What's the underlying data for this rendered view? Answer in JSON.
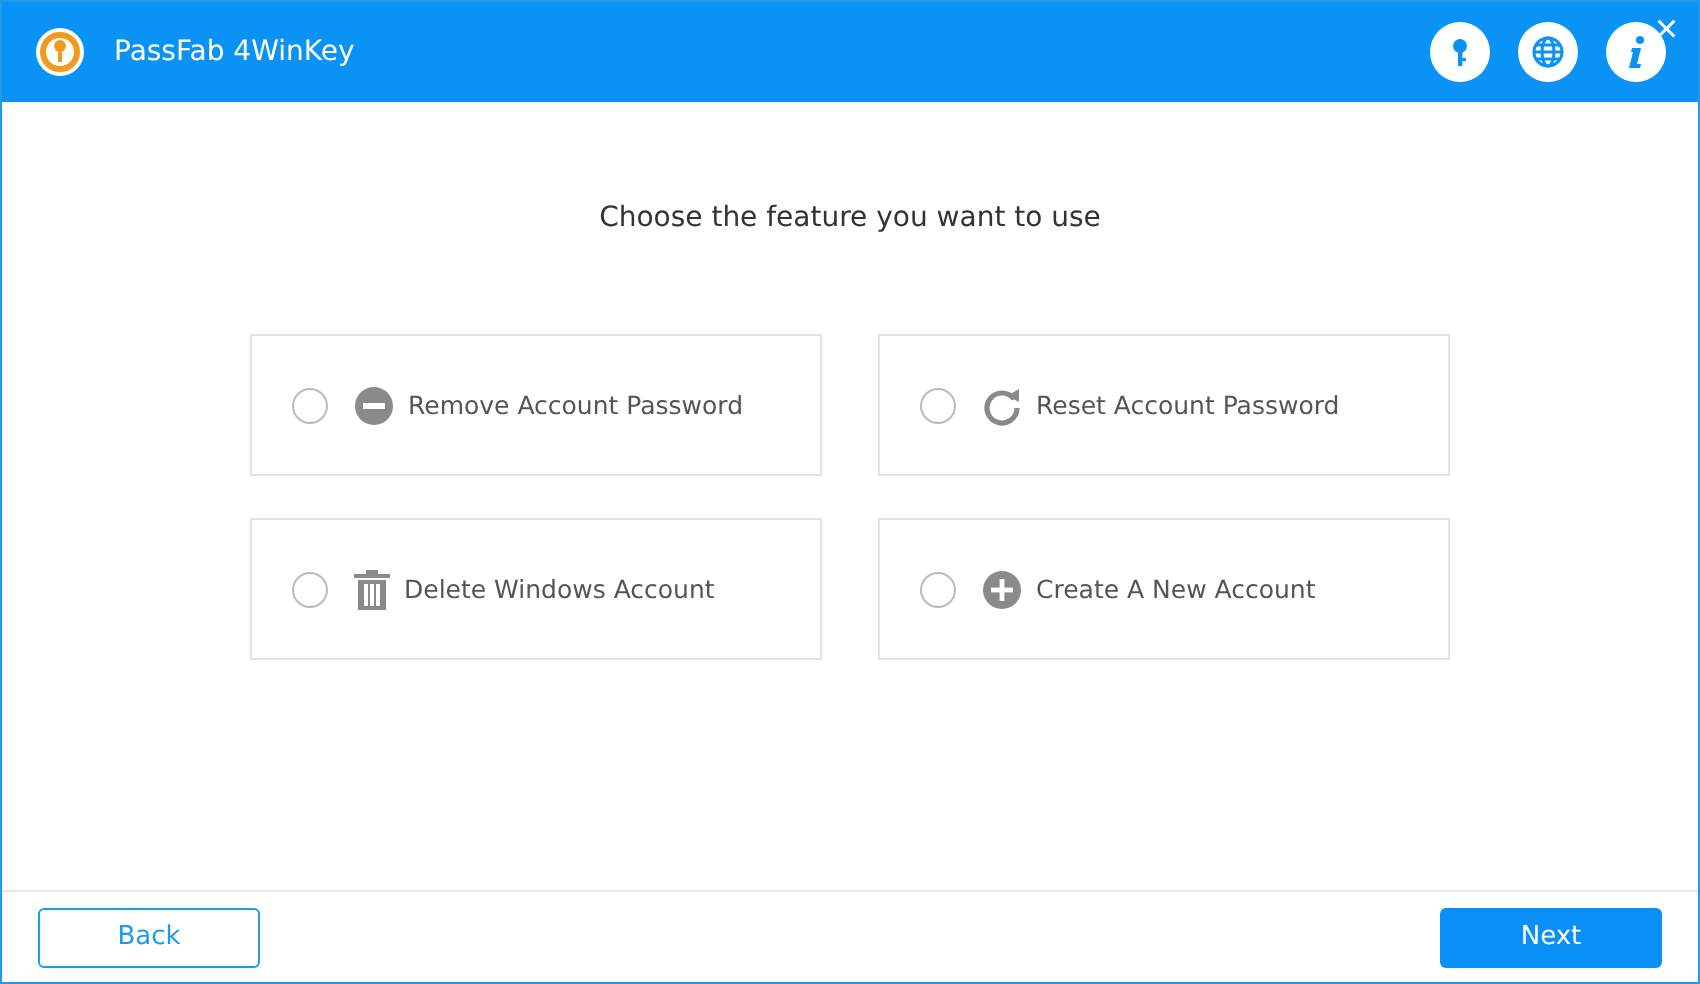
{
  "window": {
    "title": "PassFab 4WinKey",
    "close": "×"
  },
  "heading": "Choose the feature you want to use",
  "options": [
    {
      "label": "Remove Account Password",
      "kind": "remove",
      "selected": false
    },
    {
      "label": "Reset Account Password",
      "kind": "reset",
      "selected": false
    },
    {
      "label": "Delete Windows Account",
      "kind": "delete",
      "selected": false
    },
    {
      "label": "Create A New Account",
      "kind": "create",
      "selected": false
    }
  ],
  "buttons": {
    "back": "Back",
    "next": "Next"
  }
}
